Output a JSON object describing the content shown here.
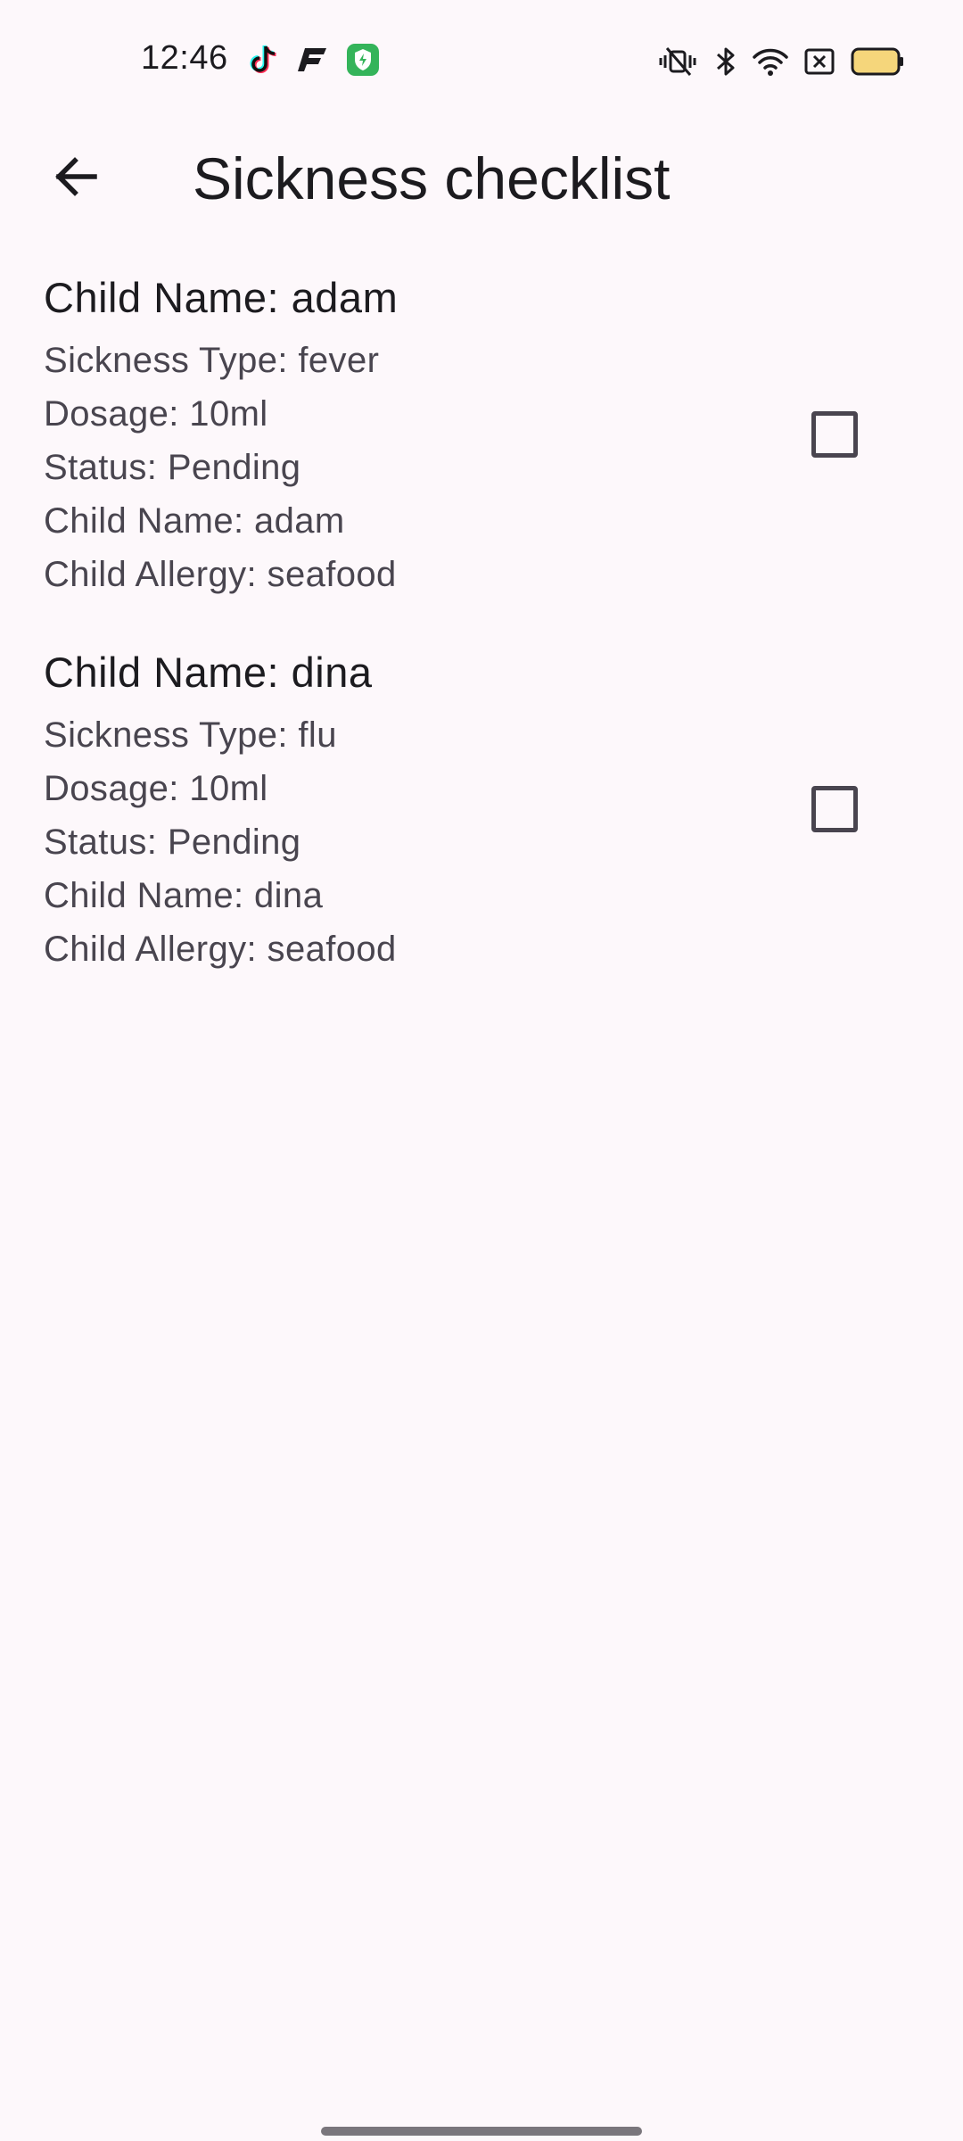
{
  "status_bar": {
    "time": "12:46",
    "notification_icons": [
      "tiktok-icon",
      "flashscore-icon",
      "security-shield-icon"
    ],
    "system_icons": [
      "vibrate-silent-icon",
      "bluetooth-icon",
      "wifi-icon",
      "sim-none-icon",
      "battery-icon"
    ],
    "battery_color": "#f5d67b"
  },
  "app_bar": {
    "title": "Sickness checklist",
    "back_icon": "arrow-back-icon"
  },
  "items": [
    {
      "title": "Child Name: adam",
      "sickness_type": "Sickness Type: fever",
      "dosage": "Dosage: 10ml",
      "status": "Status: Pending",
      "child_name": "Child Name: adam",
      "child_allergy": "Child Allergy: seafood",
      "checked": false
    },
    {
      "title": "Child Name: dina",
      "sickness_type": "Sickness Type: flu",
      "dosage": "Dosage: 10ml",
      "status": "Status: Pending",
      "child_name": "Child Name: dina",
      "child_allergy": "Child Allergy: seafood",
      "checked": false
    }
  ],
  "colors": {
    "background": "#fdf8fb",
    "primary_text": "#1c1b1f",
    "secondary_text": "#49454f"
  }
}
